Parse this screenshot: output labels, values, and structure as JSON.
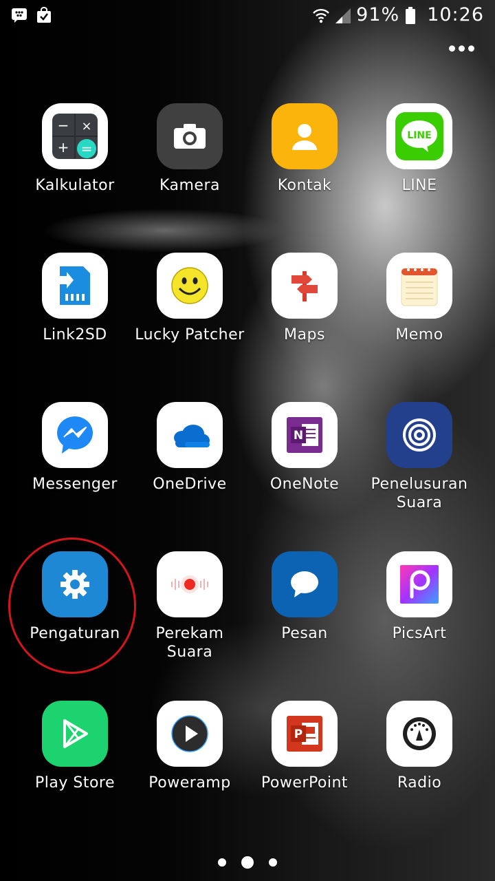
{
  "status_bar": {
    "left_icons": [
      "bbm-icon",
      "shopping-bag-check-icon"
    ],
    "right_icons": [
      "wifi-icon",
      "signal-icon",
      "battery-icon"
    ],
    "battery": "91%",
    "time": "10:26"
  },
  "apps": [
    {
      "label": "Kalkulator",
      "icon": "calculator-icon"
    },
    {
      "label": "Kamera",
      "icon": "camera-icon"
    },
    {
      "label": "Kontak",
      "icon": "contact-icon"
    },
    {
      "label": "LINE",
      "icon": "line-icon"
    },
    {
      "label": "Link2SD",
      "icon": "sdcard-icon"
    },
    {
      "label": "Lucky Patcher",
      "icon": "smiley-icon"
    },
    {
      "label": "Maps",
      "icon": "signpost-icon"
    },
    {
      "label": "Memo",
      "icon": "notepad-icon"
    },
    {
      "label": "Messenger",
      "icon": "messenger-icon"
    },
    {
      "label": "OneDrive",
      "icon": "cloud-icon"
    },
    {
      "label": "OneNote",
      "icon": "onenote-icon"
    },
    {
      "label": "Penelusuran\nSuara",
      "icon": "voice-search-icon"
    },
    {
      "label": "Pengaturan",
      "icon": "gear-icon"
    },
    {
      "label": "Perekam\nSuara",
      "icon": "voice-recorder-icon"
    },
    {
      "label": "Pesan",
      "icon": "message-bubble-icon"
    },
    {
      "label": "PicsArt",
      "icon": "picsart-icon"
    },
    {
      "label": "Play Store",
      "icon": "play-store-icon"
    },
    {
      "label": "Poweramp",
      "icon": "play-circle-icon"
    },
    {
      "label": "PowerPoint",
      "icon": "powerpoint-icon"
    },
    {
      "label": "Radio",
      "icon": "radio-icon"
    }
  ],
  "highlighted_app": "Pengaturan",
  "highlight_color": "#d2161b",
  "page_indicator": {
    "pages": 3,
    "current": 2
  }
}
